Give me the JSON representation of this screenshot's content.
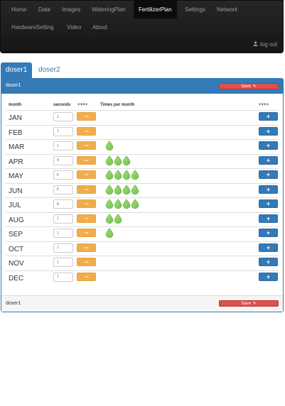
{
  "nav": {
    "items": [
      {
        "label": "Home"
      },
      {
        "label": "Data"
      },
      {
        "label": "Images"
      },
      {
        "label": "WateringPlan"
      },
      {
        "label": "FertilizerPlan"
      },
      {
        "label": "Settings"
      },
      {
        "label": "Network"
      },
      {
        "label": "HardwareSetting"
      },
      {
        "label": "Video"
      },
      {
        "label": "About"
      }
    ],
    "active": "FertilizerPlan",
    "logout_label": "log out",
    "logout_icon": "user-icon"
  },
  "tabs": [
    {
      "label": "doser1"
    },
    {
      "label": "doser2"
    }
  ],
  "panel": {
    "title": "doser1",
    "footer_title": "doser1",
    "save_label": "Save",
    "save_icon": "pencil-square-icon"
  },
  "table": {
    "headers": {
      "month": "month",
      "seconds": "seconds",
      "minus": "++++",
      "times": "Times per month",
      "plus": "++++"
    },
    "rows": [
      {
        "month": "JAN",
        "seconds": "1",
        "times": 0
      },
      {
        "month": "FEB",
        "seconds": "1",
        "times": 0
      },
      {
        "month": "MAR",
        "seconds": "1",
        "times": 1
      },
      {
        "month": "APR",
        "seconds": "4",
        "times": 3
      },
      {
        "month": "MAY",
        "seconds": "6",
        "times": 4
      },
      {
        "month": "JUN",
        "seconds": "6",
        "times": 4
      },
      {
        "month": "JUL",
        "seconds": "8",
        "times": 4
      },
      {
        "month": "AUG",
        "seconds": "1",
        "times": 2
      },
      {
        "month": "SEP",
        "seconds": "1",
        "times": 1
      },
      {
        "month": "OCT",
        "seconds": "1",
        "times": 0
      },
      {
        "month": "NOV",
        "seconds": "1",
        "times": 0
      },
      {
        "month": "DEC",
        "seconds": "1",
        "times": 0
      }
    ],
    "minus_label": "−",
    "plus_label": "+"
  },
  "colors": {
    "navbar": "#1e1e1e",
    "primary": "#337ab7",
    "warning": "#f0ad4e",
    "danger": "#d9534f",
    "drop": "#6cc24a"
  }
}
